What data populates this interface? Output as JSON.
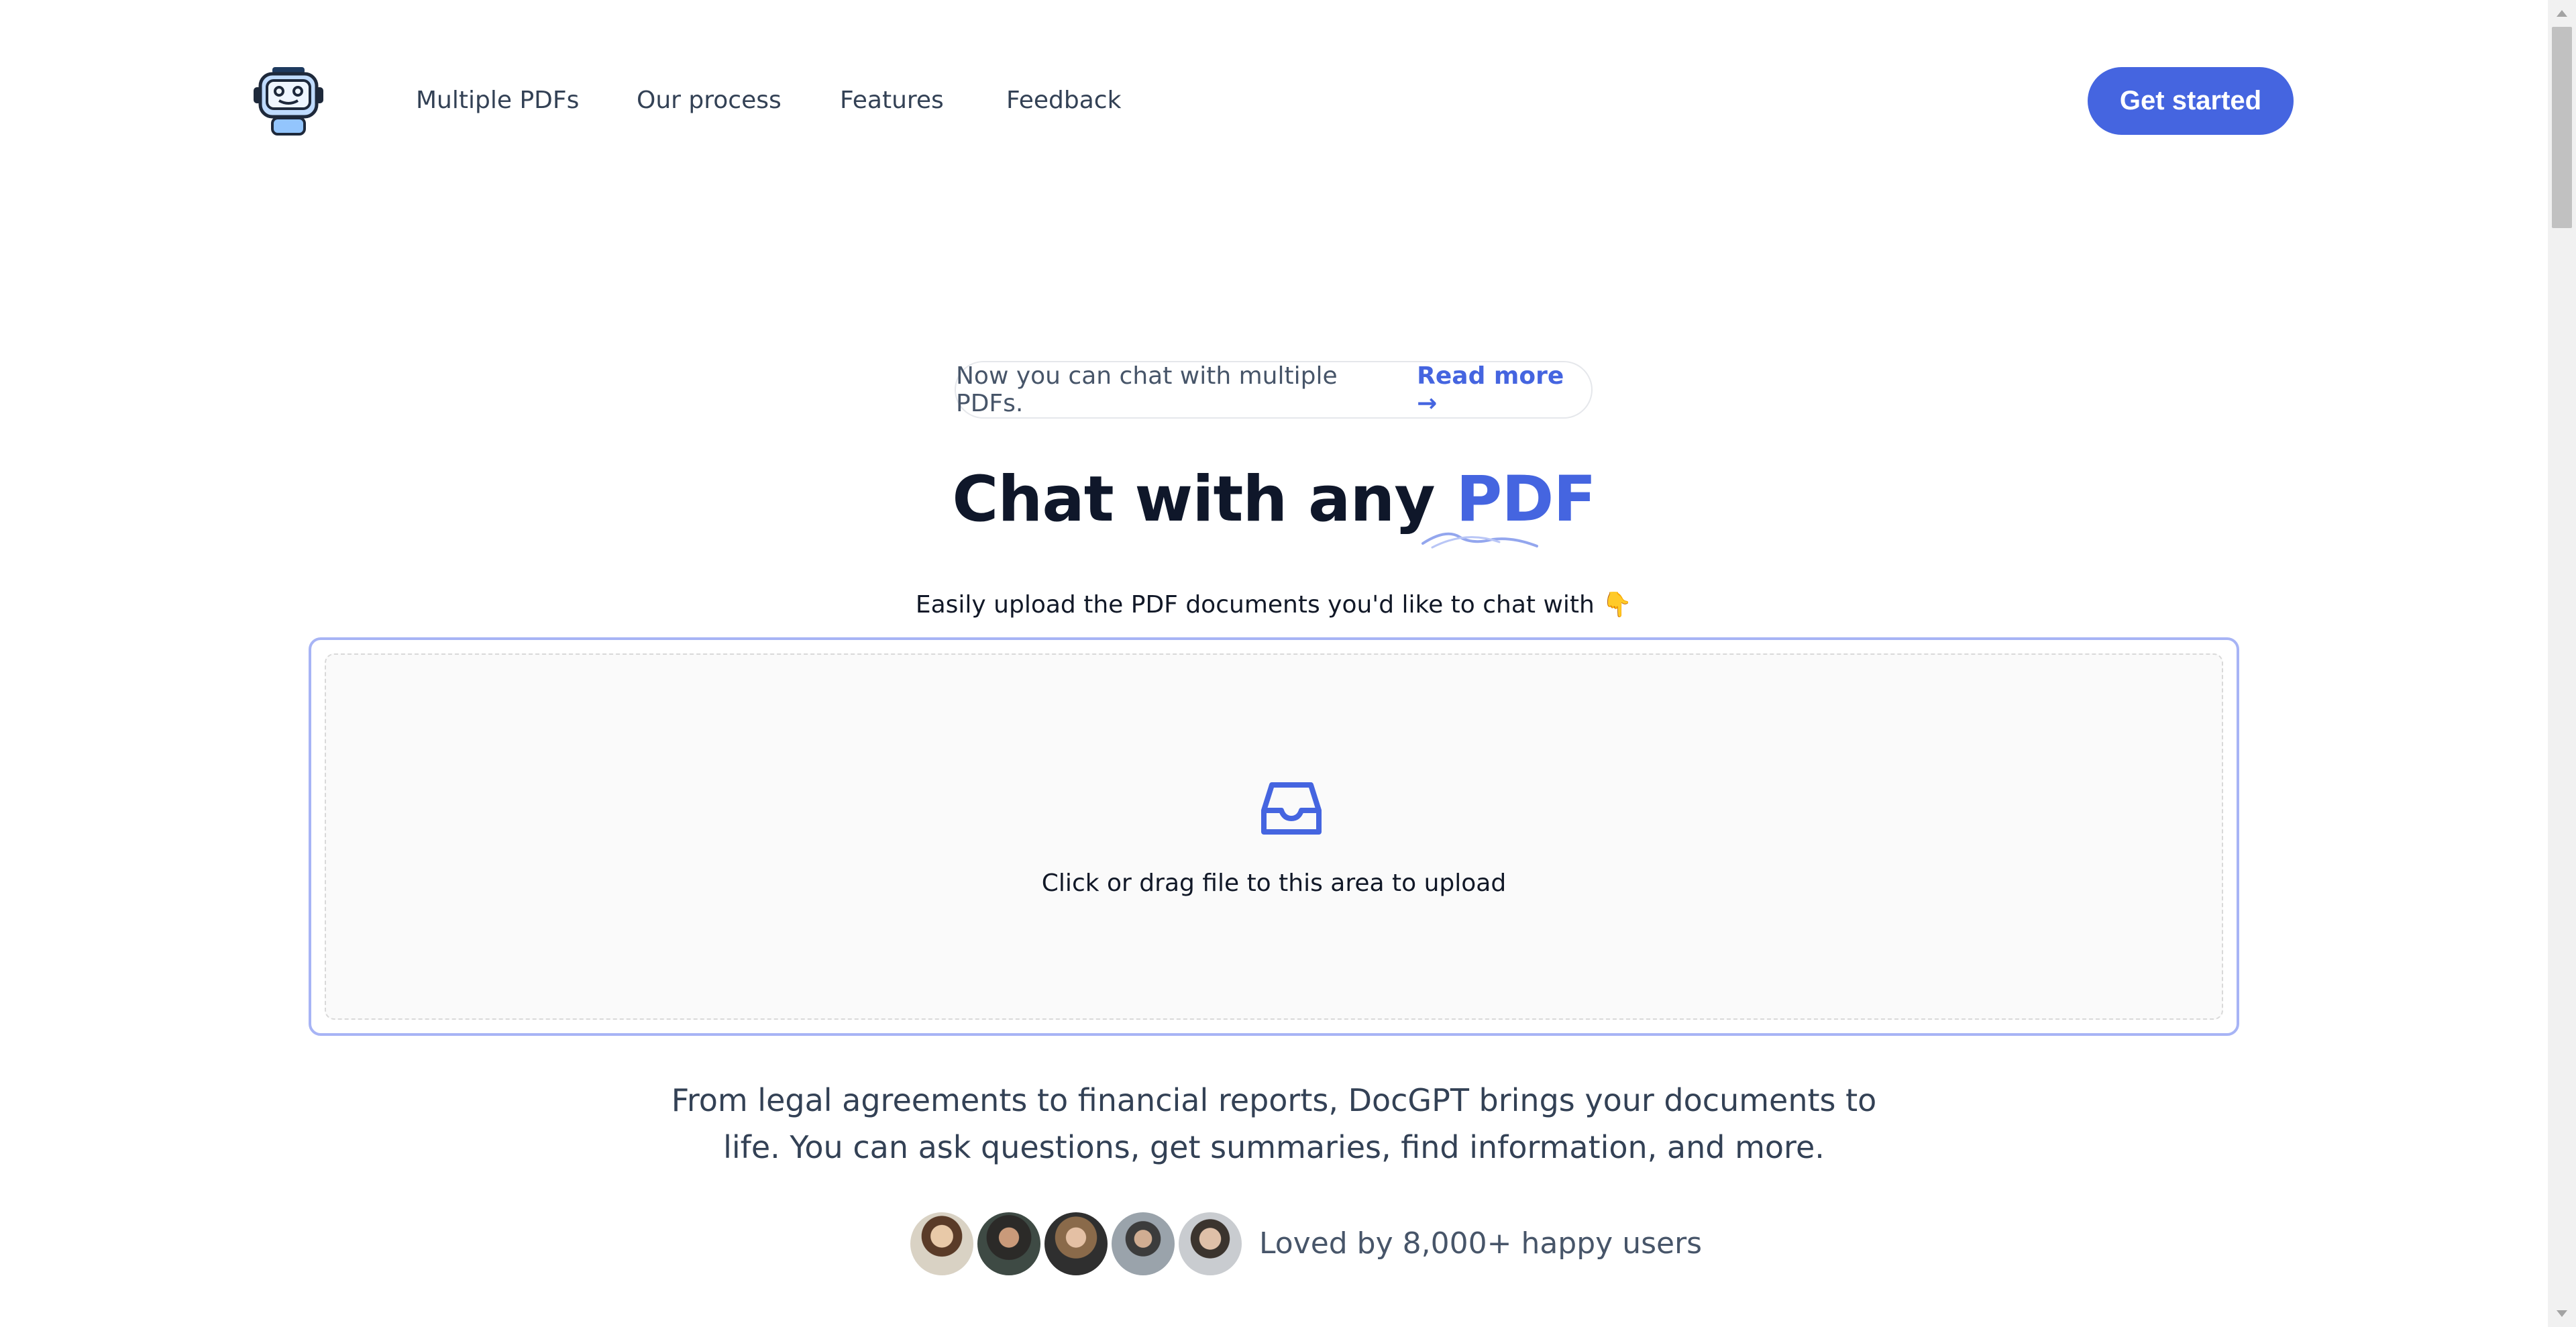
{
  "header": {
    "nav": [
      "Multiple PDFs",
      "Our process",
      "Features",
      "Feedback"
    ],
    "cta_label": "Get started"
  },
  "announcement": {
    "text": "Now you can chat with multiple PDFs.",
    "link_label": "Read more →"
  },
  "hero": {
    "title_plain": "Chat with any ",
    "title_accent": "PDF",
    "subtitle": "Easily upload the PDF documents you'd like to chat with 👇"
  },
  "upload": {
    "label": "Click or drag file to this area to upload"
  },
  "description": {
    "line1": "From legal agreements to financial reports, DocGPT brings your documents to",
    "line2": "life. You can ask questions, get summaries, find information, and more."
  },
  "social_proof": {
    "label": "Loved by 8,000+ happy users"
  },
  "colors": {
    "accent": "#4565e0",
    "upload_border": "#a7b4f5"
  }
}
